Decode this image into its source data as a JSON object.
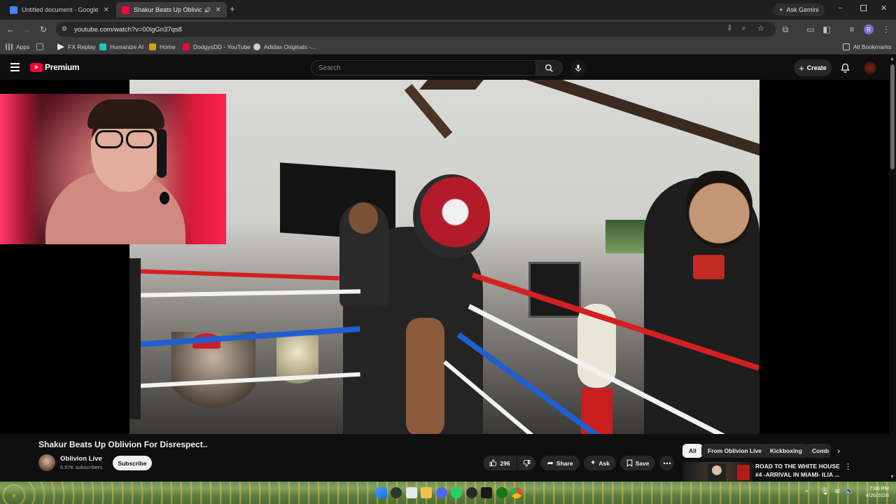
{
  "browser": {
    "tabs": [
      {
        "title": "Untitled document - Google Docs",
        "favicon_color": "#4285f4",
        "close": "✕"
      },
      {
        "title": "Shakur Beats Up Oblivion For Disrespect..",
        "favicon_color": "#ff0033",
        "close": "✕"
      }
    ],
    "new_tab": "+",
    "ask_gemini": "Ask Gemini",
    "url": "youtube.com/watch?v=00lgGn37qs8",
    "bookmarks": [
      {
        "label": "Apps",
        "color": "#9aa0a6"
      },
      {
        "label": "",
        "color": "#9aa0a6"
      },
      {
        "label": "FX Replay",
        "color": "#e8e8e8"
      },
      {
        "label": "Humanize AI",
        "color": "#22c5b8"
      },
      {
        "label": "Home",
        "color": "#d4a017"
      },
      {
        "label": "DodgysDD - YouTube",
        "color": "#ff0033"
      },
      {
        "label": "Adidas Originals -...",
        "color": "#cfcfcf"
      }
    ],
    "all_bookmarks": "All Bookmarks",
    "profile_initial": "R"
  },
  "youtube": {
    "logo_text": "Premium",
    "search_placeholder": "Search",
    "create_label": "Create",
    "video": {
      "title": "Shakur Beats Up Oblivion For Disrespect..",
      "channel": "Oblivion Live",
      "subscribers": "6.57K subscribers",
      "subscribe_label": "Subscribe",
      "likes": "296",
      "share_label": "Share",
      "ask_label": "Ask",
      "save_label": "Save"
    },
    "chips": [
      "All",
      "From Oblivion Live",
      "Kickboxing",
      "Comb"
    ],
    "recommendation": {
      "title": "ROAD TO THE WHITE HOUSE #4 -ARRIVAL IN MIAMI- ILIA ..."
    }
  },
  "taskbar": {
    "time": "7:06 PM",
    "date": "4/26/2026"
  },
  "colors": {
    "youtube_red": "#ff0033",
    "background": "#0f0f0f",
    "chip_bg": "#272727"
  }
}
